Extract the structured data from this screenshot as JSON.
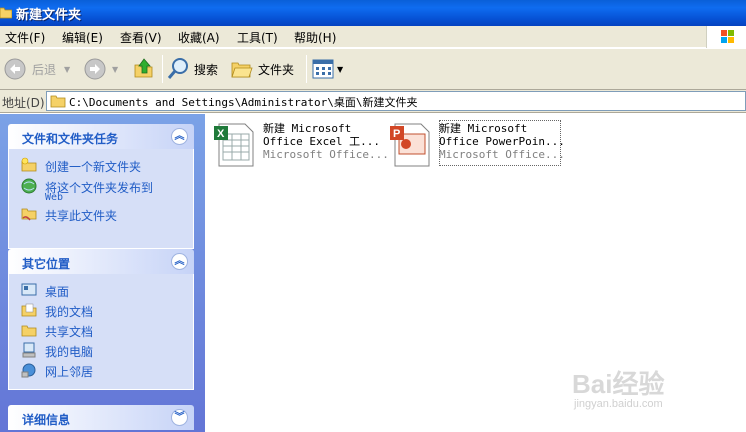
{
  "window": {
    "title": "新建文件夹"
  },
  "menu": [
    "文件(F)",
    "编辑(E)",
    "查看(V)",
    "收藏(A)",
    "工具(T)",
    "帮助(H)"
  ],
  "toolbar": {
    "back": "后退",
    "search": "搜索",
    "folders": "文件夹"
  },
  "address": {
    "label": "地址(D)",
    "path": "C:\\Documents and Settings\\Administrator\\桌面\\新建文件夹"
  },
  "taskpane": {
    "file_tasks": {
      "title": "文件和文件夹任务",
      "items": [
        "创建一个新文件夹",
        "将这个文件夹发布到",
        "Web",
        "共享此文件夹"
      ]
    },
    "other_places": {
      "title": "其它位置",
      "items": [
        "桌面",
        "我的文档",
        "共享文档",
        "我的电脑",
        "网上邻居"
      ]
    },
    "details": {
      "title": "详细信息"
    }
  },
  "files": [
    {
      "name1": "新建 Microsoft",
      "name2": "Office Excel 工...",
      "type": "Microsoft Office..."
    },
    {
      "name1": "新建 Microsoft",
      "name2": "Office PowerPoin...",
      "type": "Microsoft Office..."
    }
  ],
  "watermark": {
    "brand": "Bai经验",
    "url": "jingyan.baidu.com"
  }
}
